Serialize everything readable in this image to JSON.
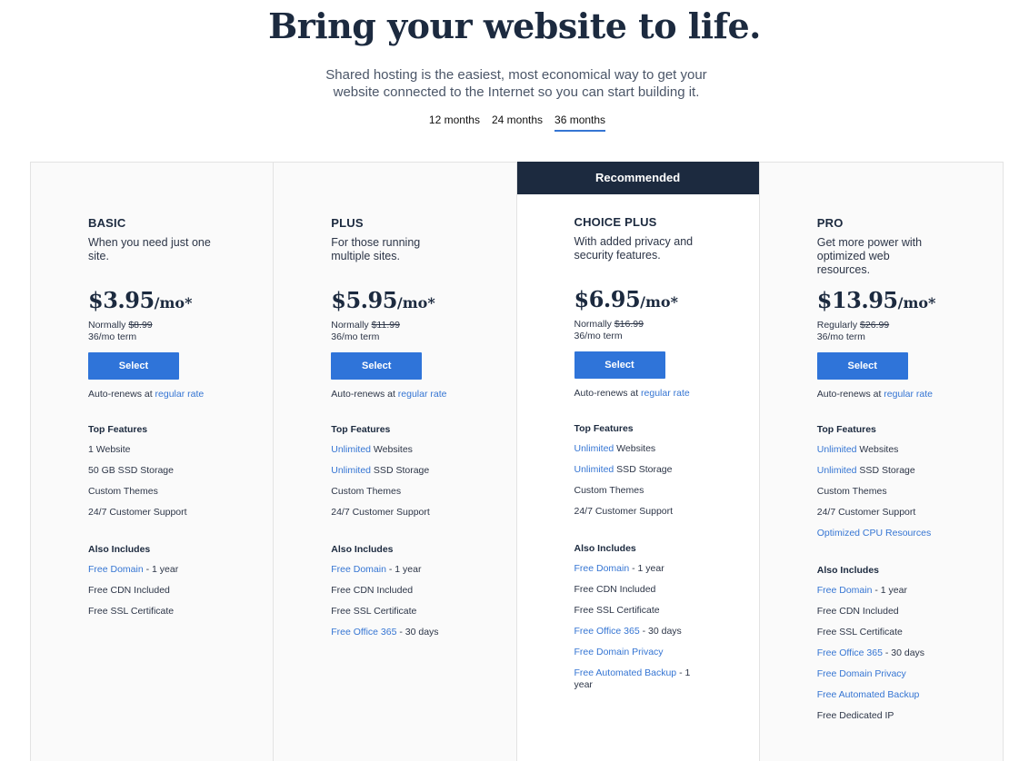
{
  "hero": {
    "title": "Bring your website to life.",
    "subtitle_line1": "Shared hosting is the easiest, most economical way to get your",
    "subtitle_line2": "website connected to the Internet so you can start building it."
  },
  "terms": {
    "options": [
      "12 months",
      "24 months",
      "36 months"
    ],
    "selected": "36 months"
  },
  "colors": {
    "accent": "#2f74d9",
    "link": "#3575d3",
    "dark": "#1c2a3f",
    "column_bg": "#fafafa"
  },
  "plans": [
    {
      "name": "BASIC",
      "description": "When you need just one site.",
      "price": "$3.95",
      "per": "/mo*",
      "normally_label": "Normally",
      "normal_price": "$8.99",
      "term": "36/mo term",
      "select_label": "Select",
      "renews_text": "Auto-renews at",
      "renews_link": "regular rate",
      "top_features_title": "Top Features",
      "top_features": [
        {
          "link": "",
          "text": "1 Website"
        },
        {
          "link": "",
          "text": "50 GB SSD Storage"
        },
        {
          "link": "",
          "text": "Custom Themes"
        },
        {
          "link": "",
          "text": "24/7 Customer Support"
        }
      ],
      "also_title": "Also Includes",
      "also": [
        {
          "link": "Free Domain",
          "text": " - 1 year"
        },
        {
          "link": "",
          "text": "Free CDN Included"
        },
        {
          "link": "",
          "text": "Free SSL Certificate"
        }
      ]
    },
    {
      "name": "PLUS",
      "description": "For those running multiple sites.",
      "price": "$5.95",
      "per": "/mo*",
      "normally_label": "Normally",
      "normal_price": "$11.99",
      "term": "36/mo term",
      "select_label": "Select",
      "renews_text": "Auto-renews at",
      "renews_link": "regular rate",
      "top_features_title": "Top Features",
      "top_features": [
        {
          "link": "Unlimited",
          "text": " Websites"
        },
        {
          "link": "Unlimited",
          "text": " SSD Storage"
        },
        {
          "link": "",
          "text": "Custom Themes"
        },
        {
          "link": "",
          "text": "24/7 Customer Support"
        }
      ],
      "also_title": "Also Includes",
      "also": [
        {
          "link": "Free Domain",
          "text": " - 1 year"
        },
        {
          "link": "",
          "text": "Free CDN Included"
        },
        {
          "link": "",
          "text": "Free SSL Certificate"
        },
        {
          "link": "Free Office 365",
          "text": " - 30 days"
        }
      ]
    },
    {
      "name": "CHOICE PLUS",
      "badge": "Recommended",
      "description": "With added privacy and security features.",
      "price": "$6.95",
      "per": "/mo*",
      "normally_label": "Normally",
      "normal_price": "$16.99",
      "term": "36/mo term",
      "select_label": "Select",
      "renews_text": "Auto-renews at",
      "renews_link": "regular rate",
      "top_features_title": "Top Features",
      "top_features": [
        {
          "link": "Unlimited",
          "text": " Websites"
        },
        {
          "link": "Unlimited",
          "text": " SSD Storage"
        },
        {
          "link": "",
          "text": "Custom Themes"
        },
        {
          "link": "",
          "text": "24/7 Customer Support"
        }
      ],
      "also_title": "Also Includes",
      "also": [
        {
          "link": "Free Domain",
          "text": " - 1 year"
        },
        {
          "link": "",
          "text": "Free CDN Included"
        },
        {
          "link": "",
          "text": "Free SSL Certificate"
        },
        {
          "link": "Free Office 365",
          "text": " - 30 days"
        },
        {
          "link": "Free Domain Privacy",
          "text": ""
        },
        {
          "link": "Free Automated Backup",
          "text": " - 1 year"
        }
      ]
    },
    {
      "name": "PRO",
      "description": "Get more power with optimized web resources.",
      "price": "$13.95",
      "per": "/mo*",
      "normally_label": "Regularly",
      "normal_price": "$26.99",
      "term": "36/mo term",
      "select_label": "Select",
      "renews_text": "Auto-renews at",
      "renews_link": "regular rate",
      "top_features_title": "Top Features",
      "top_features": [
        {
          "link": "Unlimited",
          "text": " Websites"
        },
        {
          "link": "Unlimited",
          "text": " SSD Storage"
        },
        {
          "link": "",
          "text": "Custom Themes"
        },
        {
          "link": "",
          "text": "24/7 Customer Support"
        },
        {
          "link": "Optimized CPU Resources",
          "text": ""
        }
      ],
      "also_title": "Also Includes",
      "also": [
        {
          "link": "Free Domain",
          "text": " - 1 year"
        },
        {
          "link": "",
          "text": "Free CDN Included"
        },
        {
          "link": "",
          "text": "Free SSL Certificate"
        },
        {
          "link": "Free Office 365",
          "text": " - 30 days"
        },
        {
          "link": "Free Domain Privacy",
          "text": ""
        },
        {
          "link": "Free Automated Backup",
          "text": ""
        },
        {
          "link": "",
          "text": "Free Dedicated IP"
        }
      ]
    }
  ]
}
